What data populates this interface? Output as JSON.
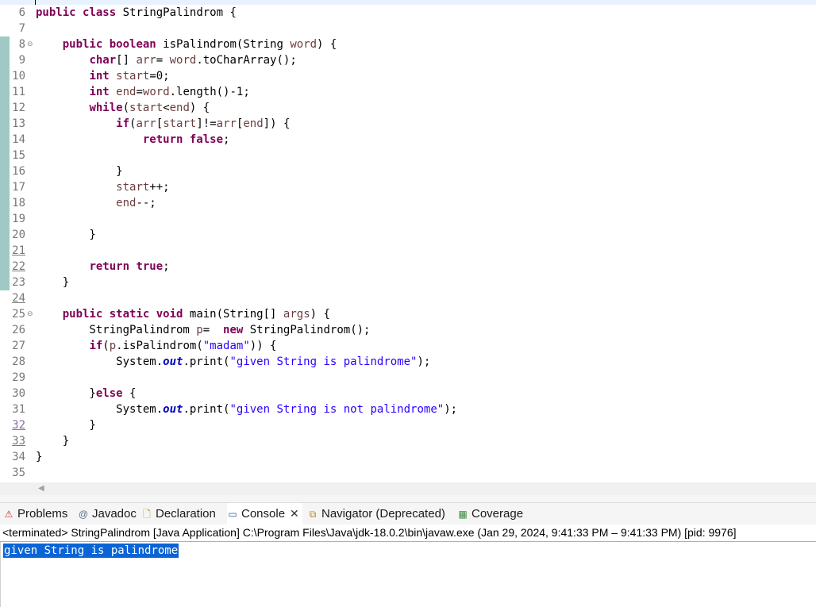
{
  "editor": {
    "lines": [
      {
        "n": "6",
        "html": "<span class=\"k\">public</span> <span class=\"k\">class</span> StringPalindrom {"
      },
      {
        "n": "7",
        "html": ""
      },
      {
        "n": "8",
        "fold": true,
        "html": "    <span class=\"k\">public</span> <span class=\"k\">boolean</span> isPalindrom(String <span class=\"v\">word</span>) {"
      },
      {
        "n": "9",
        "html": "        <span class=\"k\">char</span>[] <span class=\"v\">arr</span>= <span class=\"v\">word</span>.toCharArray();"
      },
      {
        "n": "10",
        "html": "        <span class=\"k\">int</span> <span class=\"v\">start</span>=0;"
      },
      {
        "n": "11",
        "html": "        <span class=\"k\">int</span> <span class=\"v\">end</span>=<span class=\"v\">word</span>.length()-1;"
      },
      {
        "n": "12",
        "html": "        <span class=\"k\">while</span>(<span class=\"v\">start</span>&lt;<span class=\"v\">end</span>) {"
      },
      {
        "n": "13",
        "html": "            <span class=\"k\">if</span>(<span class=\"v\">arr</span>[<span class=\"v\">start</span>]!=<span class=\"v\">arr</span>[<span class=\"v\">end</span>]) {"
      },
      {
        "n": "14",
        "html": "                <span class=\"k\">return</span> <span class=\"k\">false</span>;"
      },
      {
        "n": "15",
        "html": ""
      },
      {
        "n": "16",
        "html": "            }"
      },
      {
        "n": "17",
        "html": "            <span class=\"v\">start</span>++;"
      },
      {
        "n": "18",
        "html": "            <span class=\"v\">end</span>--;"
      },
      {
        "n": "19",
        "html": ""
      },
      {
        "n": "20",
        "html": "        }"
      },
      {
        "n": "21",
        "ul": true,
        "html": ""
      },
      {
        "n": "22",
        "ul": true,
        "html": "        <span class=\"k\">return</span> <span class=\"k\">true</span>;"
      },
      {
        "n": "23",
        "html": "    }"
      },
      {
        "n": "24",
        "ul": true,
        "html": ""
      },
      {
        "n": "25",
        "fold": true,
        "html": "    <span class=\"k\">public</span> <span class=\"k\">static</span> <span class=\"k\">void</span> main(String[] <span class=\"v\">args</span>) {"
      },
      {
        "n": "26",
        "html": "        StringPalindrom <span class=\"v\">p</span>=  <span class=\"k\">new</span> StringPalindrom();"
      },
      {
        "n": "27",
        "html": "        <span class=\"k\">if</span>(<span class=\"v\">p</span>.isPalindrom(<span class=\"s\">\"madam\"</span>)) {"
      },
      {
        "n": "28",
        "html": "            System.<span class=\"f\">out</span>.print(<span class=\"s\">\"given String is palindrome\"</span>);"
      },
      {
        "n": "29",
        "html": ""
      },
      {
        "n": "30",
        "html": "        }<span class=\"k\">else</span> {"
      },
      {
        "n": "31",
        "html": "            System.<span class=\"f\">out</span>.print(<span class=\"s\">\"given String is not palindrome\"</span>);"
      },
      {
        "n": "32",
        "ul": true,
        "hl": true,
        "html": "        }"
      },
      {
        "n": "33",
        "ul": true,
        "html": "    }"
      },
      {
        "n": "34",
        "html": "}"
      },
      {
        "n": "35",
        "html": ""
      }
    ]
  },
  "tabs": [
    {
      "label": "Problems",
      "icon": "problems-icon",
      "glyph": "⚠",
      "iconColor": "#c0392b"
    },
    {
      "label": "Javadoc",
      "icon": "javadoc-icon",
      "glyph": "@",
      "iconColor": "#5a6e8c"
    },
    {
      "label": "Declaration",
      "icon": "declaration-icon",
      "glyph": "🗋",
      "iconColor": "#b8860b"
    },
    {
      "label": "Console",
      "icon": "console-icon",
      "glyph": "▭",
      "iconColor": "#2d5f9a",
      "active": true,
      "closable": true
    },
    {
      "label": "Navigator (Deprecated)",
      "icon": "navigator-icon",
      "glyph": "⧉",
      "iconColor": "#c08020"
    },
    {
      "label": "Coverage",
      "icon": "coverage-icon",
      "glyph": "▦",
      "iconColor": "#3a8a3a"
    }
  ],
  "console": {
    "status": "<terminated> StringPalindrom [Java Application] C:\\Program Files\\Java\\jdk-18.0.2\\bin\\javaw.exe  (Jan 29, 2024, 9:41:33 PM – 9:41:33 PM) [pid: 9976]",
    "output": "given String is palindrome"
  },
  "icons": {
    "close": "close-icon"
  }
}
